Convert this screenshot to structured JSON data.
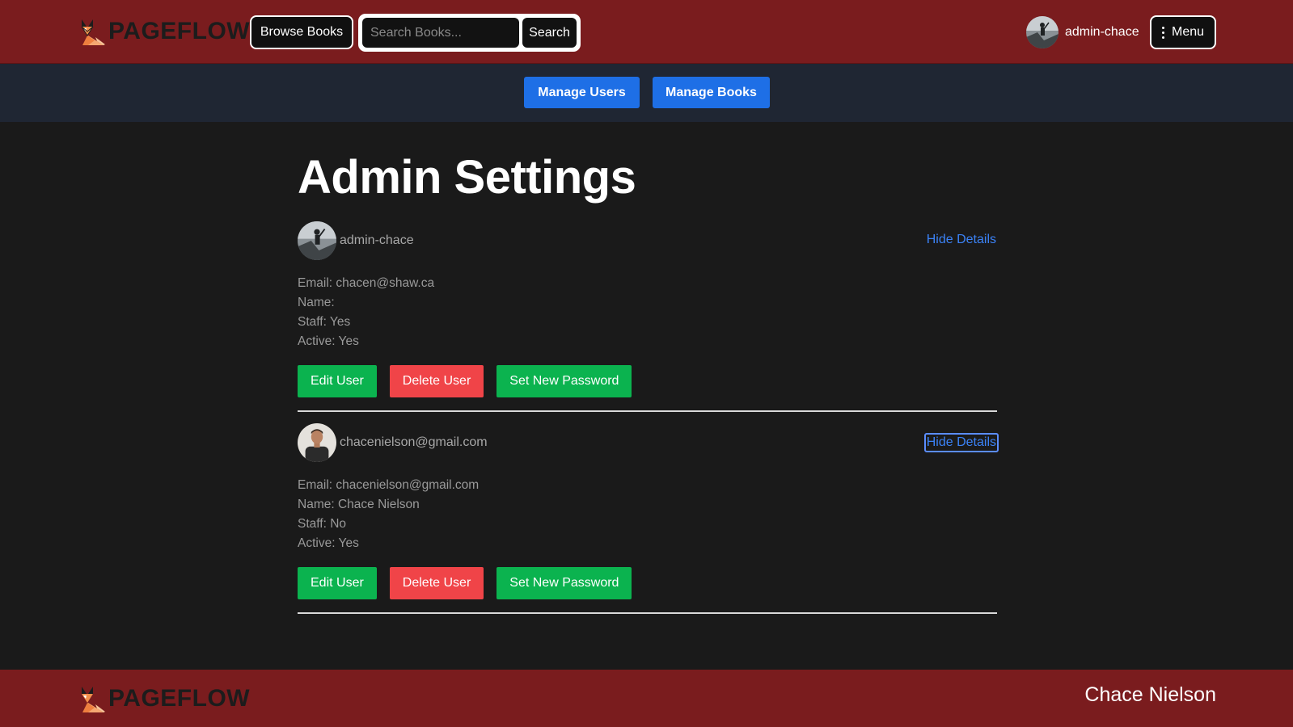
{
  "header": {
    "brand": "PAGEFLOW",
    "browse_label": "Browse Books",
    "search_placeholder": "Search Books...",
    "search_label": "Search",
    "username": "admin-chace",
    "menu_label": "Menu"
  },
  "admin_nav": {
    "manage_users": "Manage Users",
    "manage_books": "Manage Books"
  },
  "page": {
    "title": "Admin Settings"
  },
  "users": [
    {
      "username": "admin-chace",
      "toggle_label": "Hide Details",
      "email_line": "Email: chacen@shaw.ca",
      "name_line": "Name:",
      "staff_line": "Staff: Yes",
      "active_line": "Active: Yes",
      "edit_label": "Edit User",
      "delete_label": "Delete User",
      "password_label": "Set New Password"
    },
    {
      "username": "chacenielson@gmail.com",
      "toggle_label": "Hide Details",
      "email_line": "Email: chacenielson@gmail.com",
      "name_line": "Name: Chace Nielson",
      "staff_line": "Staff: No",
      "active_line": "Active: Yes",
      "edit_label": "Edit User",
      "delete_label": "Delete User",
      "password_label": "Set New Password"
    }
  ],
  "footer": {
    "brand": "PAGEFLOW",
    "author": "Chace Nielson"
  },
  "icons": {
    "logo": "fox-logo-icon",
    "menu": "vertical-dots-icon"
  },
  "colors": {
    "header_bg": "#7a1c1e",
    "subnav_bg": "#1f2633",
    "page_bg": "#1a1a1a",
    "primary": "#1e6fe6",
    "success": "#0bb34f",
    "danger": "#f04448",
    "link": "#3b82f6"
  }
}
